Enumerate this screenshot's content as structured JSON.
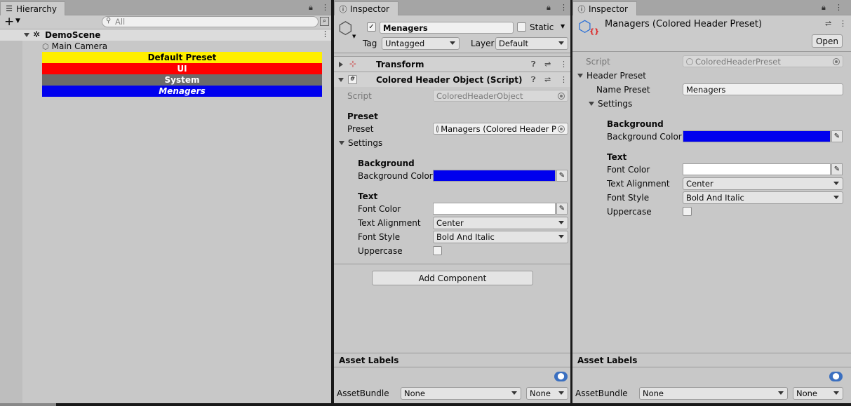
{
  "hierarchy": {
    "tab_label": "Hierarchy",
    "search_placeholder": "All",
    "scene_name": "DemoScene",
    "items": [
      {
        "label": "Main Camera"
      },
      {
        "label": "Default Preset",
        "bg": "#ffef00",
        "fg": "#000000",
        "italic": false
      },
      {
        "label": "UI",
        "bg": "#ff0000",
        "fg": "#ffffff",
        "italic": false
      },
      {
        "label": "System",
        "bg": "#6b6b6b",
        "fg": "#ffffff",
        "italic": false
      },
      {
        "label": "Menagers",
        "bg": "#0000ee",
        "fg": "#ffffff",
        "italic": true
      }
    ]
  },
  "inspector_object": {
    "tab_label": "Inspector",
    "object_name": "Menagers",
    "static_label": "Static",
    "tag_label": "Tag",
    "tag_value": "Untagged",
    "layer_label": "Layer",
    "layer_value": "Default",
    "transform_label": "Transform",
    "component_title": "Colored Header Object (Script)",
    "script_label": "Script",
    "script_value": "ColoredHeaderObject",
    "preset_section": "Preset",
    "preset_label": "Preset",
    "preset_value": "Managers (Colored Header P",
    "settings_label": "Settings",
    "background_section": "Background",
    "background_color_label": "Background Color",
    "background_color": "#0000ee",
    "text_section": "Text",
    "font_color_label": "Font Color",
    "font_color": "#ffffff",
    "text_alignment_label": "Text Alignment",
    "text_alignment_value": "Center",
    "font_style_label": "Font Style",
    "font_style_value": "Bold And Italic",
    "uppercase_label": "Uppercase",
    "add_component_label": "Add Component",
    "asset_labels": "Asset Labels",
    "assetbundle_label": "AssetBundle",
    "assetbundle_value": "None",
    "assetbundle_variant": "None"
  },
  "inspector_preset": {
    "tab_label": "Inspector",
    "title": "Managers (Colored Header Preset)",
    "open_label": "Open",
    "script_label": "Script",
    "script_value": "ColoredHeaderPreset",
    "header_preset_label": "Header Preset",
    "name_preset_label": "Name Preset",
    "name_preset_value": "Menagers",
    "settings_label": "Settings",
    "background_section": "Background",
    "background_color_label": "Background Color",
    "background_color": "#0000ee",
    "text_section": "Text",
    "font_color_label": "Font Color",
    "font_color": "#ffffff",
    "text_alignment_label": "Text Alignment",
    "text_alignment_value": "Center",
    "font_style_label": "Font Style",
    "font_style_value": "Bold And Italic",
    "uppercase_label": "Uppercase",
    "asset_labels": "Asset Labels",
    "assetbundle_label": "AssetBundle",
    "assetbundle_value": "None",
    "assetbundle_variant": "None"
  }
}
